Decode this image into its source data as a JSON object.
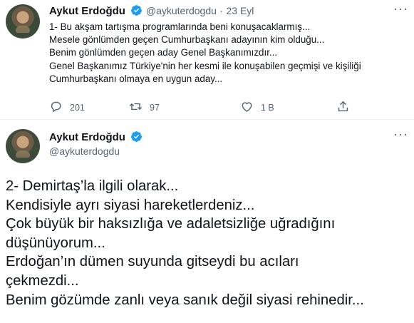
{
  "tweet1": {
    "author_name": "Aykut Erdoğdu",
    "handle": "@aykuterdogdu",
    "separator": "·",
    "date": "23 Eyl",
    "more_icon": "more-horizontal-icon",
    "verified_icon": "verified-badge-icon",
    "lines": [
      "1- Bu akşam tartışma programlarında beni konuşacaklarmış...",
      "Mesele gönlümden geçen Cumhurbaşkanı adayının kim olduğu...",
      "Benim gönlümden geçen aday Genel Başkanımızdır...",
      "Genel Başkanımız Türkiye'nin her kesmi ile konuşabilen geçmişi ve kişiliği",
      "Cumhurbaşkanı olmaya en uygun aday..."
    ],
    "actions": {
      "reply_count": "201",
      "retweet_count": "97",
      "like_count": "1 B",
      "share_label": ""
    }
  },
  "tweet2": {
    "author_name": "Aykut Erdoğdu",
    "handle": "@aykuterdogdu",
    "more_icon": "more-horizontal-icon",
    "verified_icon": "verified-badge-icon",
    "lines": [
      "2- Demirtaş’la ilgili olarak...",
      "Kendisiyle ayrı siyasi hareketlerdeniz...",
      "Çok büyük bir haksızlığa ve adaletsizliğe uğradığını",
      "düşünüyorum...",
      "Erdoğan’ın dümen suyunda gitseydi bu acıları",
      "çekmezdi...",
      "Benim gözümde zanlı veya sanık değil siyasi rehinedir..."
    ]
  },
  "colors": {
    "text": "#0f1419",
    "secondary": "#536471",
    "verified": "#1d9bf0",
    "divider": "#eff3f4"
  }
}
